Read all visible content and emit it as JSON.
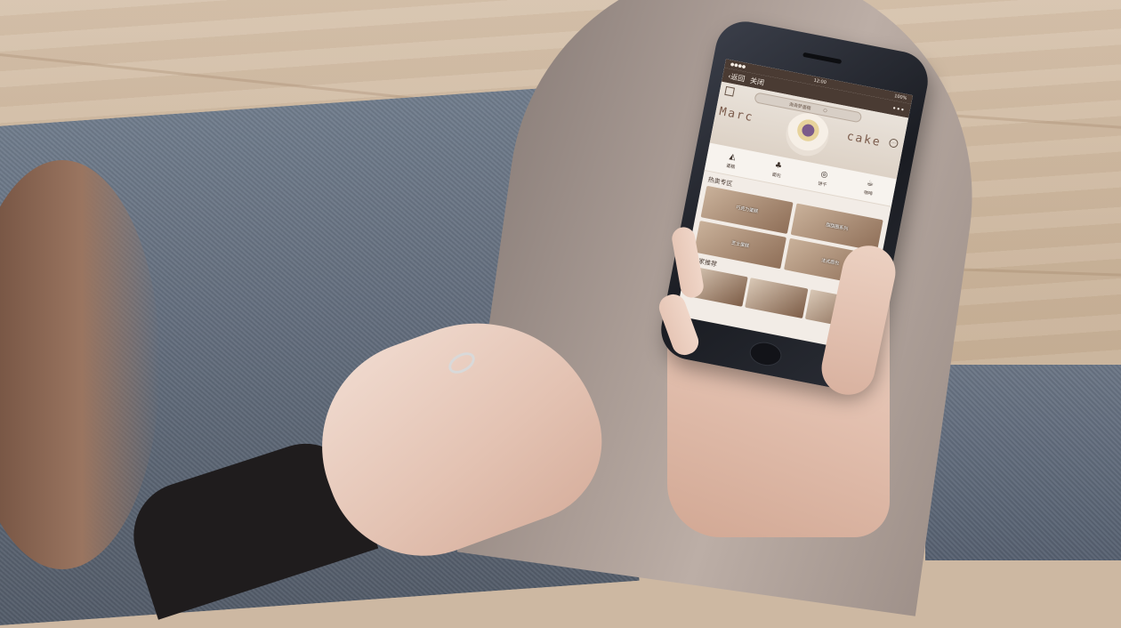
{
  "phone": {
    "status": {
      "time": "12:00",
      "battery": "100%"
    },
    "navbar": {
      "back_label": "返回",
      "close_label": "关闭",
      "more_label": "•••"
    },
    "banner": {
      "search_placeholder": "海海梦蛋糕",
      "text_left": "Marc",
      "text_right": "cake",
      "more_icon": "…"
    },
    "categories": [
      {
        "icon": "cake-icon",
        "glyph": "◭",
        "label": "蛋糕"
      },
      {
        "icon": "bread-icon",
        "glyph": "♣",
        "label": "面包"
      },
      {
        "icon": "cookie-icon",
        "glyph": "◎",
        "label": "饼干"
      },
      {
        "icon": "coffee-icon",
        "glyph": "☕",
        "label": "咖啡"
      }
    ],
    "hot_section": {
      "title": "热卖专区"
    },
    "hot_tiles": [
      "巧克力蛋糕",
      "甜甜圈系列",
      "芝士蛋糕",
      "法式面包"
    ],
    "recommend_section": {
      "title": "店家推荐"
    }
  },
  "colors": {
    "navbar": "#4a3b33",
    "accent": "#7a5a4a",
    "screen_bg": "#f2ece6"
  }
}
